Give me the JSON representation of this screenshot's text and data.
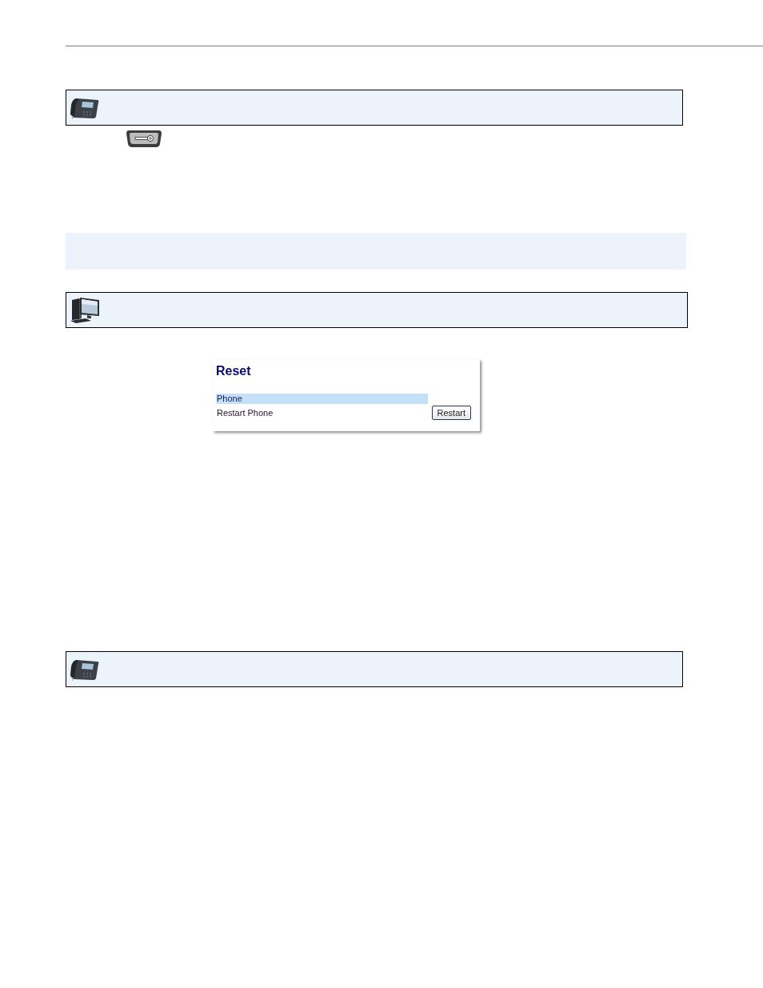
{
  "sections": [
    {
      "kind": "phone_note"
    },
    {
      "kind": "key"
    },
    {
      "kind": "shaded_band"
    },
    {
      "kind": "computer_note"
    },
    {
      "kind": "reset_panel",
      "title": "Reset",
      "group_heading": "Phone",
      "rows": [
        {
          "label": "Restart Phone",
          "button": "Restart"
        }
      ]
    },
    {
      "kind": "phone_note"
    }
  ]
}
